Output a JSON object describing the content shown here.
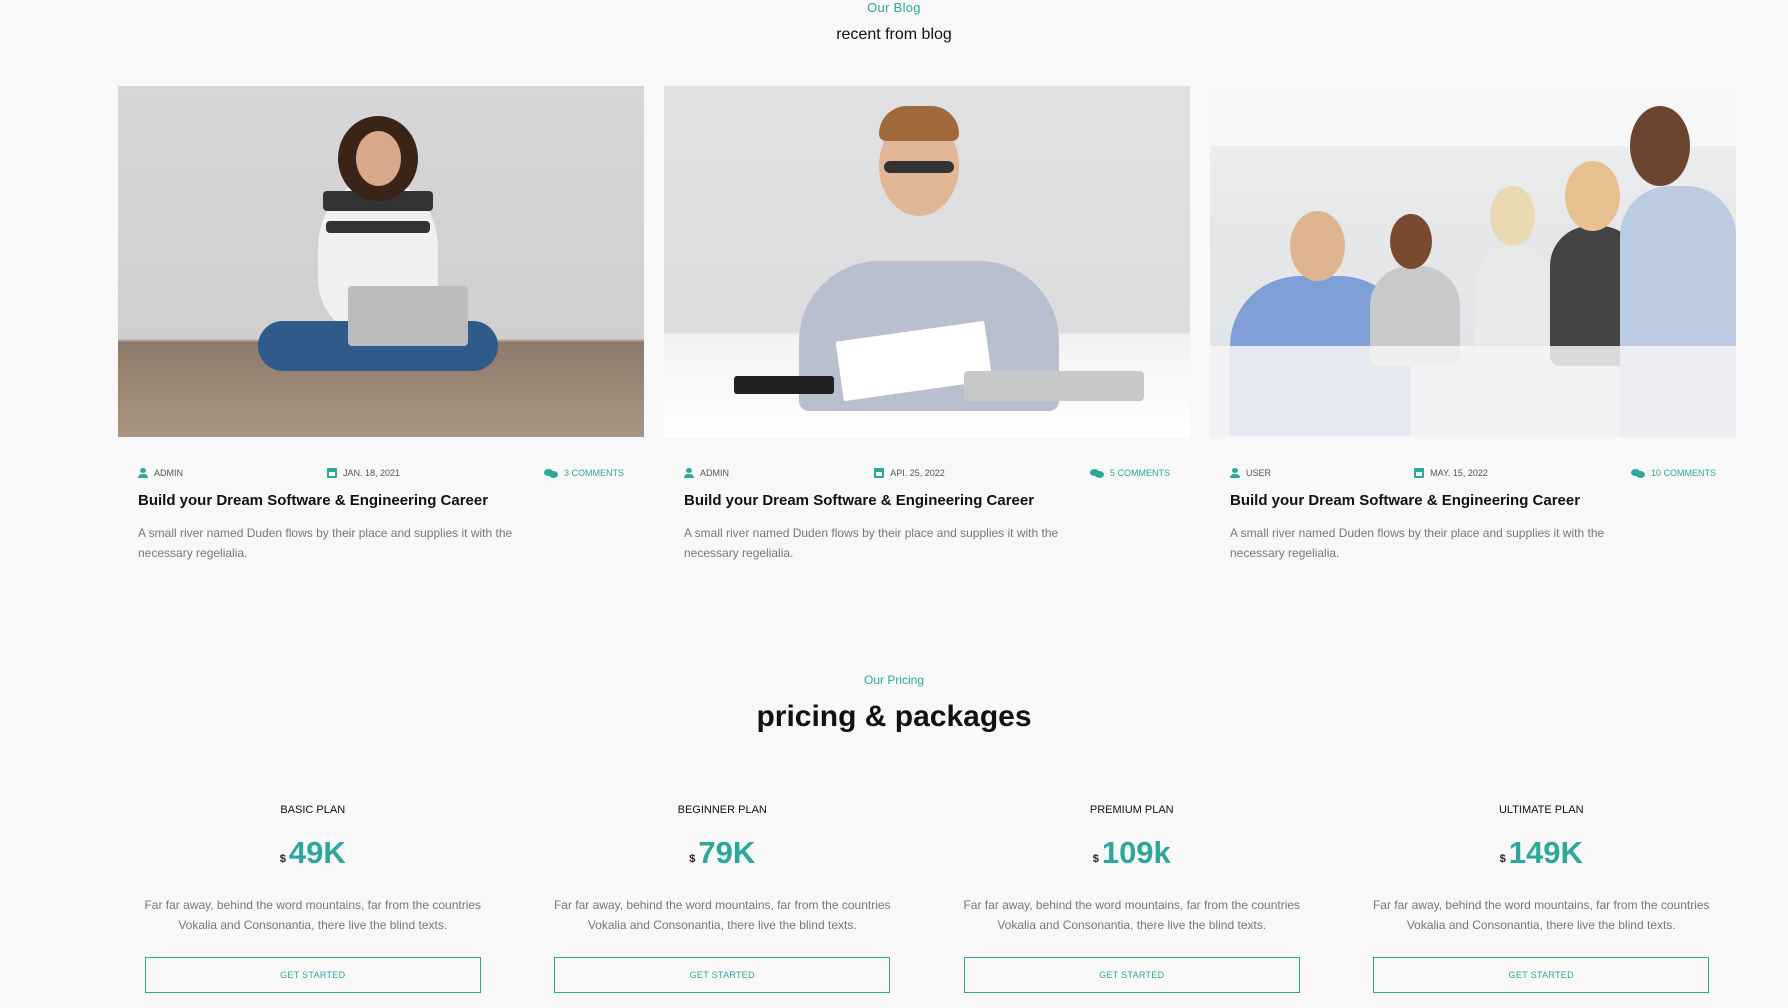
{
  "blog": {
    "eyebrow": "Our Blog",
    "title": "recent from blog",
    "posts": [
      {
        "author": "ADMIN",
        "date": "JAN. 18, 2021",
        "comments": "3 COMMENTS",
        "title": "Build your Dream Software & Engineering Career",
        "excerpt": "A small river named Duden flows by their place and supplies it with the necessary regelialia.",
        "image_alt": "Smiling woman sitting on floor with laptop giving thumbs up"
      },
      {
        "author": "ADMIN",
        "date": "API. 25, 2022",
        "comments": "5 COMMENTS",
        "title": "Build your Dream Software & Engineering Career",
        "excerpt": "A small river named Duden flows by their place and supplies it with the necessary regelialia.",
        "image_alt": "Man with glasses at desk holding papers and pen"
      },
      {
        "author": "USER",
        "date": "MAY. 15, 2022",
        "comments": "10 COMMENTS",
        "title": "Build your Dream Software & Engineering Career",
        "excerpt": "A small river named Duden flows by their place and supplies it with the necessary regelialia.",
        "image_alt": "Group of coworkers in office giving thumbs up"
      }
    ]
  },
  "pricing": {
    "eyebrow": "Our Pricing",
    "title": "pricing & packages",
    "plans": [
      {
        "name": "BASIC PLAN",
        "currency": "$",
        "price": "49K",
        "description": "Far far away, behind the word mountains, far from the countries Vokalia and Consonantia, there live the blind texts.",
        "button": "GET STARTED"
      },
      {
        "name": "BEGINNER PLAN",
        "currency": "$",
        "price": "79K",
        "description": "Far far away, behind the word mountains, far from the countries Vokalia and Consonantia, there live the blind texts.",
        "button": "GET STARTED"
      },
      {
        "name": "PREMIUM PLAN",
        "currency": "$",
        "price": "109k",
        "description": "Far far away, behind the word mountains, far from the countries Vokalia and Consonantia, there live the blind texts.",
        "button": "GET STARTED"
      },
      {
        "name": "ULTIMATE PLAN",
        "currency": "$",
        "price": "149K",
        "description": "Far far away, behind the word mountains, far from the countries Vokalia and Consonantia, there live the blind texts.",
        "button": "GET STARTED"
      }
    ]
  },
  "colors": {
    "accent": "#2ba89a",
    "background": "#f8f8f8",
    "heading": "#111111",
    "muted_text": "#777777"
  },
  "icons": {
    "author": "user-icon",
    "date": "calendar-icon",
    "comments": "comments-icon"
  }
}
